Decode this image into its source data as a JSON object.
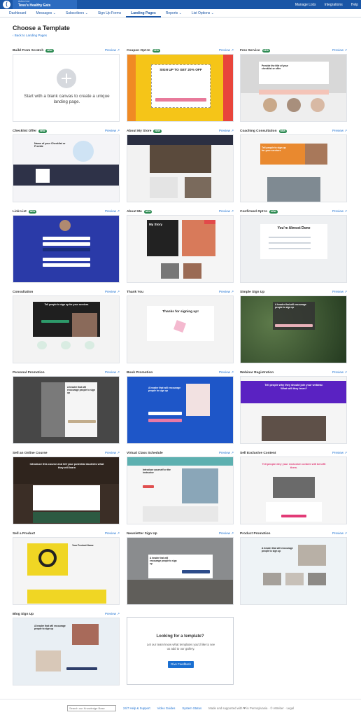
{
  "topbar": {
    "account_label": "Active List",
    "account_name": "Tess's Healthy Eats",
    "links": [
      "Manage Lists",
      "Integrations",
      "Help"
    ]
  },
  "nav": {
    "items": [
      "Dashboard",
      "Messages ⌄",
      "Subscribers ⌄",
      "Sign Up Forms",
      "Landing Pages",
      "Reports ⌄",
      "List Options ⌄"
    ],
    "active": "Landing Pages"
  },
  "page": {
    "title": "Choose a Template",
    "back_link": "‹ Back to Landing Pages",
    "preview_label": "Preview ↗",
    "new_badge": "NEW"
  },
  "cards": [
    {
      "title": "Build From Scratch",
      "new": true,
      "text": "Start with a blank canvas to create a unique landing page."
    },
    {
      "title": "Coupon Opt-In",
      "new": true,
      "text": "SIGN UP TO GET 20% OFF"
    },
    {
      "title": "Free Service",
      "new": true,
      "text": "Provide the title of your checklist or offer"
    },
    {
      "title": "Checklist Offer",
      "new": true,
      "text": "Name of your Checklist or Freebie"
    },
    {
      "title": "About My Store",
      "new": true,
      "text": ""
    },
    {
      "title": "Coaching Consultation",
      "new": true,
      "text": "Tell people to sign up for your services"
    },
    {
      "title": "Link List",
      "new": true,
      "text": ""
    },
    {
      "title": "About Me",
      "new": true,
      "text": "My Story"
    },
    {
      "title": "Confirmed Opt In",
      "new": true,
      "text": "You're Almost Done"
    },
    {
      "title": "Consultation",
      "new": false,
      "text": "Tell people to sign up for your services"
    },
    {
      "title": "Thank You",
      "new": false,
      "text": "Thanks for signing up!"
    },
    {
      "title": "Simple Sign Up",
      "new": false,
      "text": "A header that will encourage people to sign up"
    },
    {
      "title": "Personal Promotion",
      "new": false,
      "text": "A header that will encourage people to sign up"
    },
    {
      "title": "Book Promotion",
      "new": false,
      "text": "A header that will encourage people to sign up"
    },
    {
      "title": "Webinar Registration",
      "new": false,
      "text": "Tell people why they should join your webinar. What will they learn?"
    },
    {
      "title": "Sell an Online Course",
      "new": false,
      "text": "Introduce this course and tell your potential students what they will learn"
    },
    {
      "title": "Virtual Class Schedule",
      "new": false,
      "text": "Introduce yourself or the instructor"
    },
    {
      "title": "Sell Exclusive Content",
      "new": false,
      "text": "Tell people why your exclusive content will benefit them."
    },
    {
      "title": "Sell a Product",
      "new": false,
      "text": "Your Product Name"
    },
    {
      "title": "Newsletter Sign Up",
      "new": false,
      "text": "A header that will encourage people to sign up"
    },
    {
      "title": "Product Promotion",
      "new": false,
      "text": "A header that will encourage people to sign up"
    },
    {
      "title": "Blog Sign Up",
      "new": false,
      "text": "A header that will encourage people to sign up"
    }
  ],
  "request": {
    "title": "Looking for a template?",
    "text": "Let our team know what templates you'd like to see us add to our gallery.",
    "button": "Give Feedback"
  },
  "footer": {
    "search_placeholder": "Search our Knowledge Base",
    "links": [
      "24/7 Help & Support",
      "Video Guides",
      "System Status"
    ],
    "made_by": "Made and supported with ❤ in Pennsylvania · © AWeber · Legal"
  },
  "colors": {
    "brand": "#1a56a6",
    "link": "#1a6fd1",
    "new_badge": "#2c8a52"
  }
}
